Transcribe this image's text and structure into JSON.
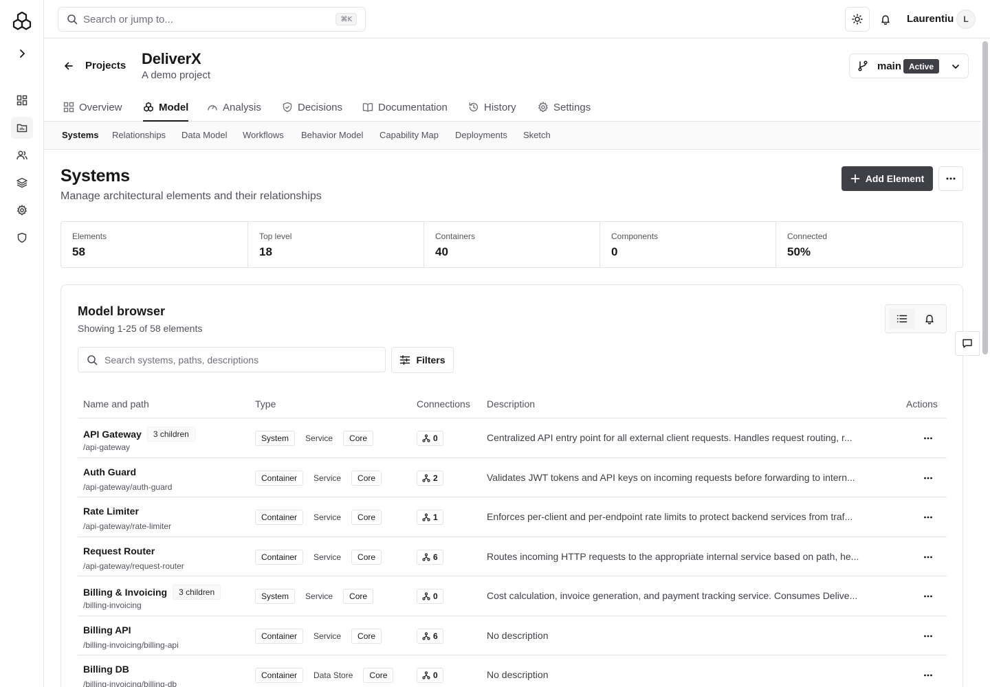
{
  "colors": {
    "accent": "#18181b",
    "button_dark": "#3f3f46",
    "border": "#e4e4e7",
    "muted_text": "#52525b"
  },
  "rail": {
    "logo_icon": "hexagon-cluster-icon",
    "items": [
      {
        "name": "dashboard-icon"
      },
      {
        "name": "projects-icon",
        "active": true
      },
      {
        "name": "users-icon"
      },
      {
        "name": "layers-icon"
      },
      {
        "name": "settings-icon"
      },
      {
        "name": "shield-icon"
      }
    ]
  },
  "topbar": {
    "search_placeholder": "Search or jump to...",
    "shortcut": "⌘K",
    "user_name": "Laurentiu",
    "avatar_initial": "L"
  },
  "project": {
    "back_label": "Projects",
    "title": "DeliverX",
    "subtitle": "A demo project",
    "branch": "main",
    "branch_status": "Active"
  },
  "tabs": [
    {
      "label": "Overview",
      "icon": "grid-icon"
    },
    {
      "label": "Model",
      "icon": "model-icon",
      "active": true
    },
    {
      "label": "Analysis",
      "icon": "gauge-icon"
    },
    {
      "label": "Decisions",
      "icon": "shield-check-icon"
    },
    {
      "label": "Documentation",
      "icon": "book-icon"
    },
    {
      "label": "History",
      "icon": "history-icon"
    },
    {
      "label": "Settings",
      "icon": "gear-icon"
    }
  ],
  "subtabs": [
    {
      "label": "Systems",
      "active": true
    },
    {
      "label": "Relationships"
    },
    {
      "label": "Data Model"
    },
    {
      "label": "Workflows"
    },
    {
      "label": "Behavior Model"
    },
    {
      "label": "Capability Map"
    },
    {
      "label": "Deployments"
    },
    {
      "label": "Sketch"
    }
  ],
  "systems": {
    "title": "Systems",
    "subtitle": "Manage architectural elements and their relationships",
    "add_label": "Add Element"
  },
  "stats": [
    {
      "label": "Elements",
      "value": "58"
    },
    {
      "label": "Top level",
      "value": "18"
    },
    {
      "label": "Containers",
      "value": "40"
    },
    {
      "label": "Components",
      "value": "0"
    },
    {
      "label": "Connected",
      "value": "50%"
    }
  ],
  "browser": {
    "title": "Model browser",
    "subtitle": "Showing 1-25 of 58 elements",
    "search_placeholder": "Search systems, paths, descriptions",
    "filters_label": "Filters",
    "columns": {
      "name": "Name and path",
      "type": "Type",
      "connections": "Connections",
      "description": "Description",
      "actions": "Actions"
    },
    "rows": [
      {
        "name": "API Gateway",
        "children": "3 children",
        "path": "/api-gateway",
        "types": [
          "System",
          "Service",
          "Core"
        ],
        "connections": "0",
        "description": "Centralized API entry point for all external client requests. Handles request routing, r..."
      },
      {
        "name": "Auth Guard",
        "children": "",
        "path": "/api-gateway/auth-guard",
        "types": [
          "Container",
          "Service",
          "Core"
        ],
        "connections": "2",
        "description": "Validates JWT tokens and API keys on incoming requests before forwarding to intern..."
      },
      {
        "name": "Rate Limiter",
        "children": "",
        "path": "/api-gateway/rate-limiter",
        "types": [
          "Container",
          "Service",
          "Core"
        ],
        "connections": "1",
        "description": "Enforces per-client and per-endpoint rate limits to protect backend services from traf..."
      },
      {
        "name": "Request Router",
        "children": "",
        "path": "/api-gateway/request-router",
        "types": [
          "Container",
          "Service",
          "Core"
        ],
        "connections": "6",
        "description": "Routes incoming HTTP requests to the appropriate internal service based on path, he..."
      },
      {
        "name": "Billing & Invoicing",
        "children": "3 children",
        "path": "/billing-invoicing",
        "types": [
          "System",
          "Service",
          "Core"
        ],
        "connections": "0",
        "description": "Cost calculation, invoice generation, and payment tracking service. Consumes Delive..."
      },
      {
        "name": "Billing API",
        "children": "",
        "path": "/billing-invoicing/billing-api",
        "types": [
          "Container",
          "Service",
          "Core"
        ],
        "connections": "6",
        "description": "No description"
      },
      {
        "name": "Billing DB",
        "children": "",
        "path": "/billing-invoicing/billing-db",
        "types": [
          "Container",
          "Data Store",
          "Core"
        ],
        "connections": "0",
        "description": "No description"
      }
    ]
  }
}
